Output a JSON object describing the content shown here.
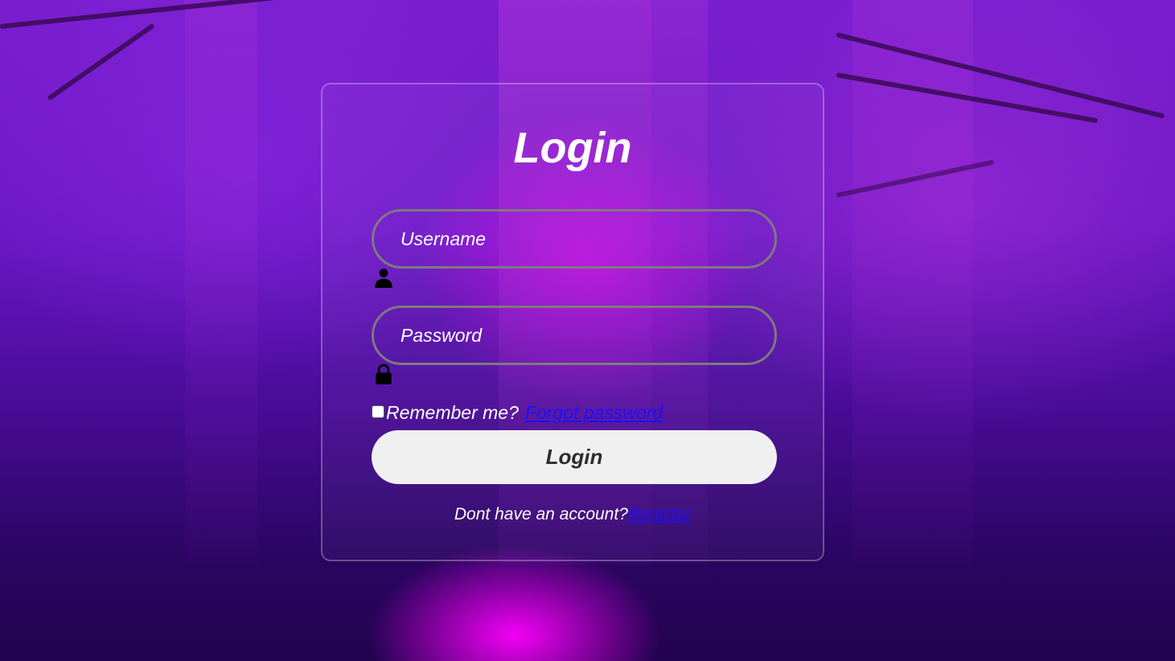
{
  "form": {
    "title": "Login",
    "username_placeholder": "Username",
    "password_placeholder": "Password",
    "remember_label": "Remember me?",
    "forgot_label": "Forgot password",
    "submit_label": "Login",
    "register_prompt": "Dont have an account?",
    "register_label": "Register"
  },
  "icons": {
    "username": "user-icon",
    "password": "lock-icon"
  },
  "colors": {
    "text": "#ffffff",
    "link": "#1a10ff",
    "button_bg": "#f0f0f0",
    "button_text": "#2d2d2d",
    "field_border": "#7d7a7d"
  }
}
